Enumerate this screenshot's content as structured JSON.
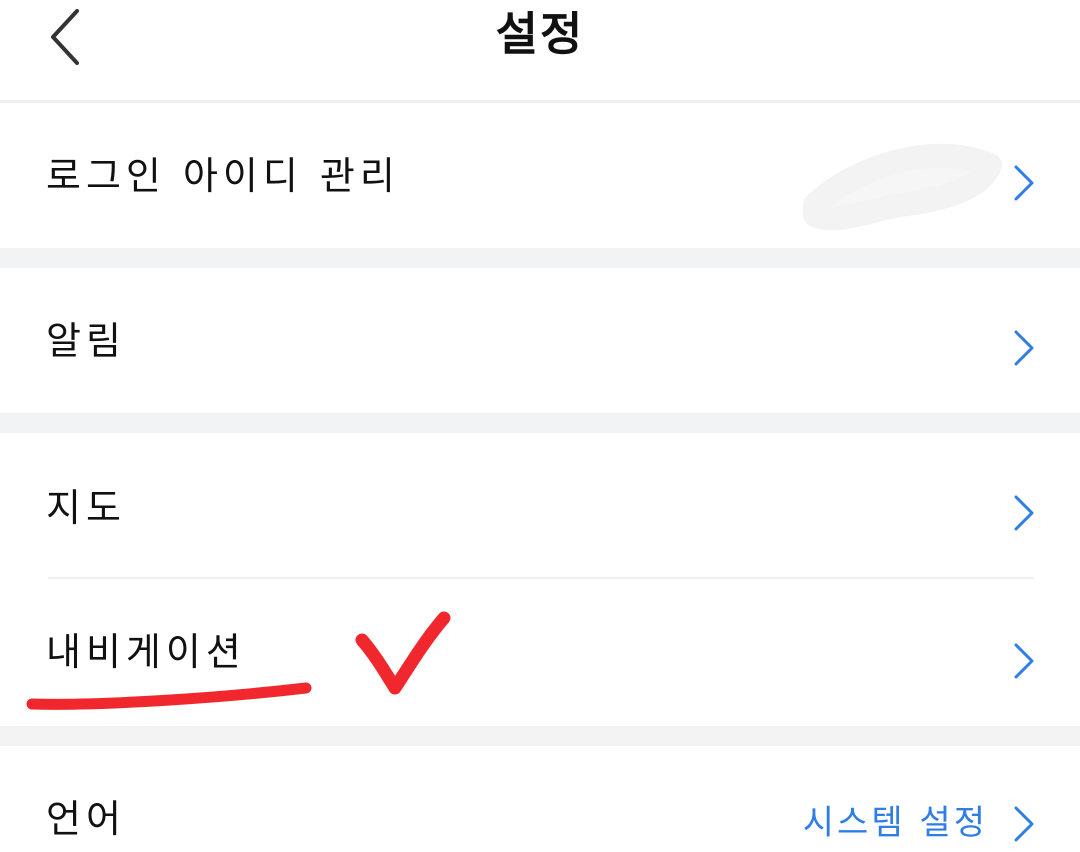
{
  "header": {
    "title": "설정",
    "back_icon": "chevron-left-icon"
  },
  "settings": {
    "items": [
      {
        "label": "로그인 아이디 관리",
        "value": ""
      },
      {
        "label": "알림",
        "value": ""
      },
      {
        "label": "지도",
        "value": ""
      },
      {
        "label": "내비게이션",
        "value": ""
      },
      {
        "label": "언어",
        "value": "시스템 설정"
      }
    ]
  },
  "colors": {
    "accent": "#2f7ee6",
    "annotation": "#f0282d",
    "section_gap": "#f2f3f5"
  }
}
